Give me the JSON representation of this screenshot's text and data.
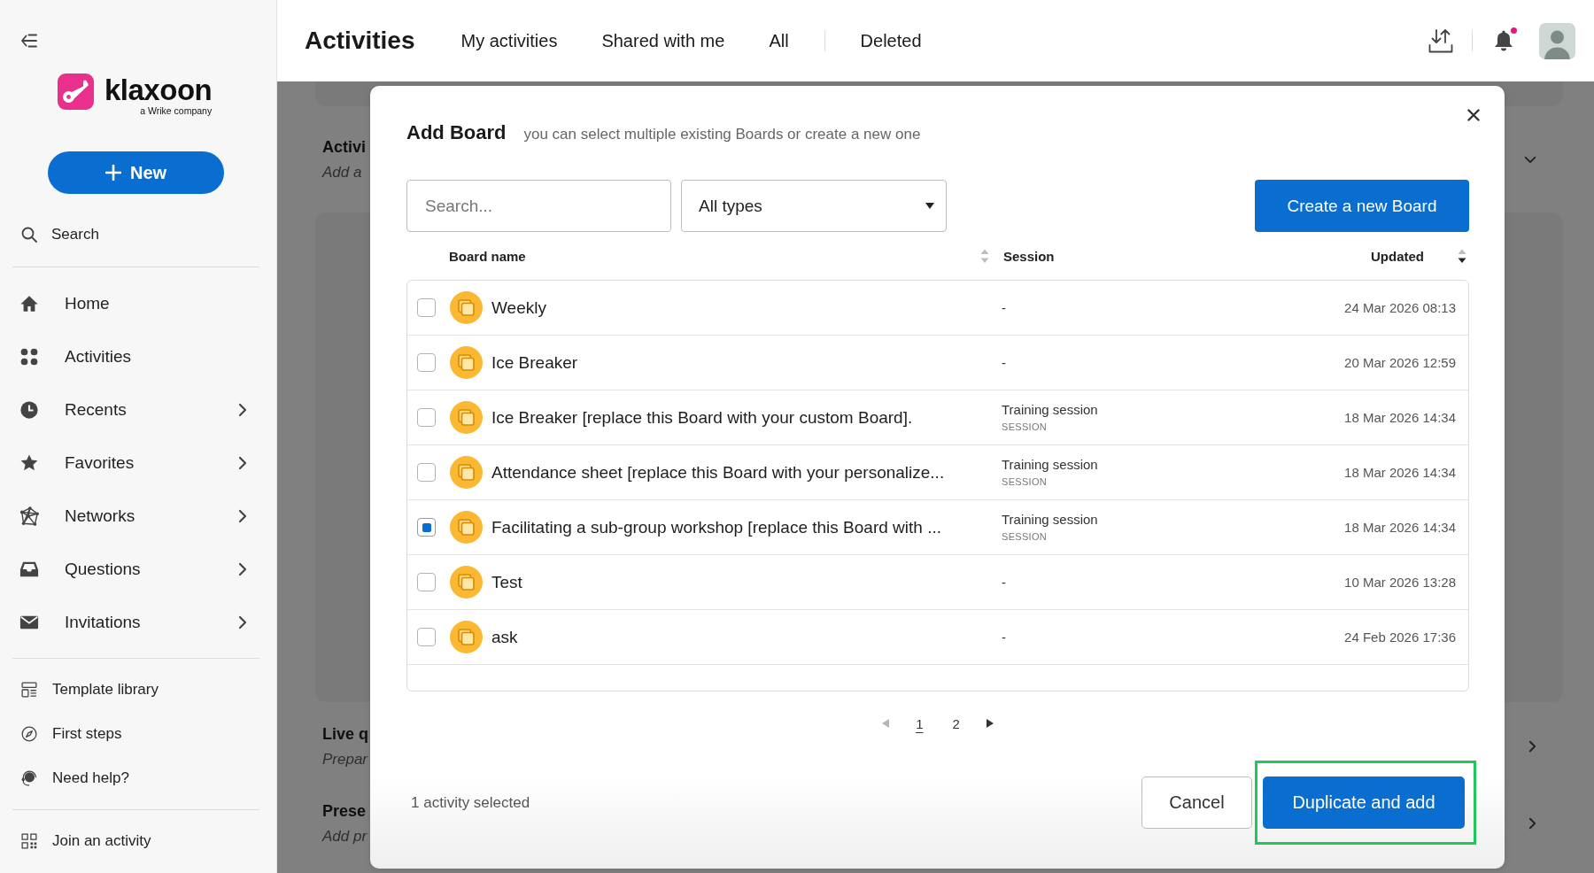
{
  "sidebar": {
    "logo": {
      "wordmark": "klaxoon",
      "tagline": "a Wrike company"
    },
    "new_button": {
      "label": "New"
    },
    "search": {
      "label": "Search"
    },
    "nav_items": [
      {
        "label": "Home",
        "expandable": false
      },
      {
        "label": "Activities",
        "expandable": false
      },
      {
        "label": "Recents",
        "expandable": true
      },
      {
        "label": "Favorites",
        "expandable": true
      },
      {
        "label": "Networks",
        "expandable": true
      },
      {
        "label": "Questions",
        "expandable": true
      },
      {
        "label": "Invitations",
        "expandable": true
      }
    ],
    "resource_items": [
      {
        "label": "Template library"
      },
      {
        "label": "First steps"
      },
      {
        "label": "Need help?"
      }
    ],
    "footer_items": [
      {
        "label": "Join an activity"
      }
    ]
  },
  "topbar": {
    "title": "Activities",
    "tabs": [
      {
        "label": "My activities",
        "selected": false,
        "divider_before": false
      },
      {
        "label": "Shared with me",
        "selected": false,
        "divider_before": false
      },
      {
        "label": "All",
        "selected": false,
        "divider_before": false
      },
      {
        "label": "Deleted",
        "selected": false,
        "divider_before": true
      }
    ],
    "notification_dot": true
  },
  "page_behind": {
    "sections": [
      {
        "title": "Activi",
        "subtitle": "Add a",
        "expanded": true
      },
      {
        "title": "Live q",
        "subtitle": "Prepar",
        "expanded": false
      },
      {
        "title": "Prese",
        "subtitle": "Add pr",
        "expanded": false
      }
    ]
  },
  "modal": {
    "title": "Add Board",
    "subtitle": "you can select multiple existing Boards or create a new one",
    "search": {
      "placeholder": "Search..."
    },
    "type_filter": {
      "value": "All types"
    },
    "create_button": {
      "label": "Create a new Board"
    },
    "table": {
      "columns": [
        {
          "label": "Board name",
          "sortable": true,
          "sorted_descending": false
        },
        {
          "label": "Session",
          "sortable": false
        },
        {
          "label": "Updated",
          "sortable": true,
          "sorted_descending": true
        }
      ],
      "rows": [
        {
          "name": "Weekly",
          "session": "-",
          "updated": "24 Mar 2026 08:13",
          "selected": false
        },
        {
          "name": "Ice Breaker",
          "session": "-",
          "updated": "20 Mar 2026 12:59",
          "selected": false
        },
        {
          "name": "Ice Breaker [replace this Board with your custom Board].",
          "session": "Training session",
          "session_type": "SESSION",
          "updated": "18 Mar 2026 14:34",
          "selected": false
        },
        {
          "name": "Attendance sheet [replace this Board with your personalize...",
          "session": "Training session",
          "session_type": "SESSION",
          "updated": "18 Mar 2026 14:34",
          "selected": false
        },
        {
          "name": "Facilitating a sub-group workshop [replace this Board with ...",
          "session": "Training session",
          "session_type": "SESSION",
          "updated": "18 Mar 2026 14:34",
          "selected": true
        },
        {
          "name": "Test",
          "session": "-",
          "updated": "10 Mar 2026 13:28",
          "selected": false
        },
        {
          "name": "ask",
          "session": "-",
          "updated": "24 Feb 2026 17:36",
          "selected": false
        }
      ]
    },
    "pagination": {
      "previous_disabled": true,
      "next_disabled": false,
      "pages": [
        {
          "label": "1",
          "selected": true
        },
        {
          "label": "2",
          "selected": false
        }
      ]
    },
    "footer": {
      "status": "1 activity selected",
      "buttons": [
        {
          "label": "Cancel",
          "kind": "secondary",
          "highlighted": false
        },
        {
          "label": "Duplicate and add",
          "kind": "primary",
          "highlighted": true
        }
      ]
    }
  }
}
